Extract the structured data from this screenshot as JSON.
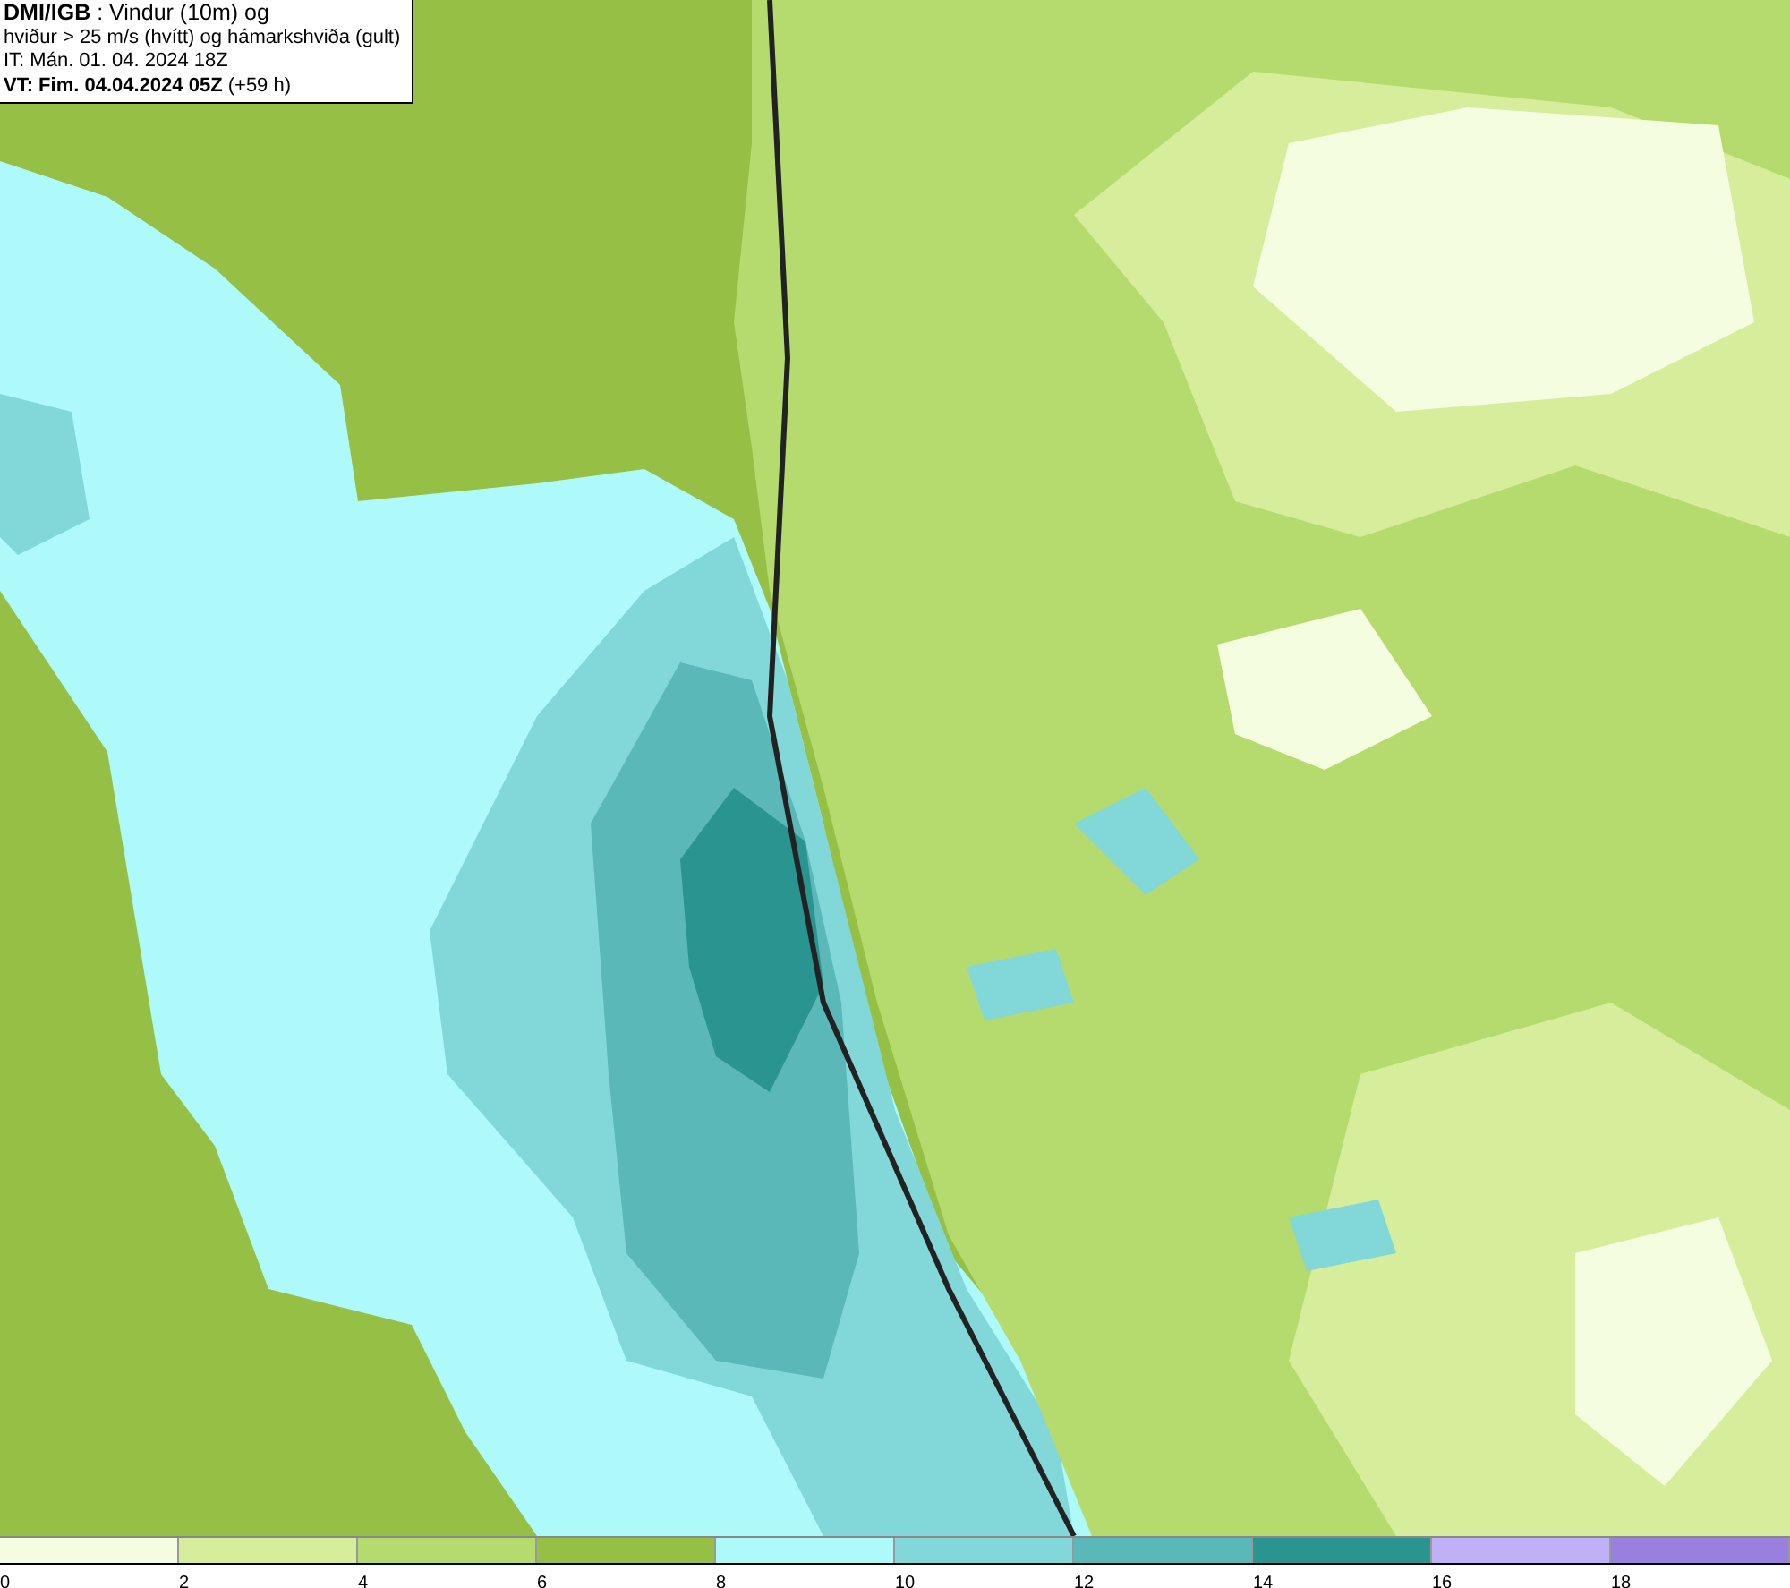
{
  "title_box": {
    "lines": [
      "**DMI/IGB** : Vindur (10m) og",
      "hviður > 25 m/s (hvítt) og hámarkshviða (gult)",
      "IT: Mán. 01. 04. 2024 18Z",
      "**VT: Fim. 04.04.2024 05Z** (+59 h)"
    ]
  },
  "legend": {
    "bins": [
      {
        "color": "#f5fde0"
      },
      {
        "color": "#d6ee9c"
      },
      {
        "color": "#b5db6e"
      },
      {
        "color": "#96bf45"
      },
      {
        "color": "#aefafa"
      },
      {
        "color": "#82d8d8"
      },
      {
        "color": "#5ab8b8"
      },
      {
        "color": "#2a9490"
      },
      {
        "color": "#c0b0f5"
      },
      {
        "color": "#9a80de"
      }
    ],
    "labels": [
      "0",
      "2",
      "4",
      "6",
      "8",
      "10",
      "12",
      "14",
      "16",
      "18"
    ]
  }
}
